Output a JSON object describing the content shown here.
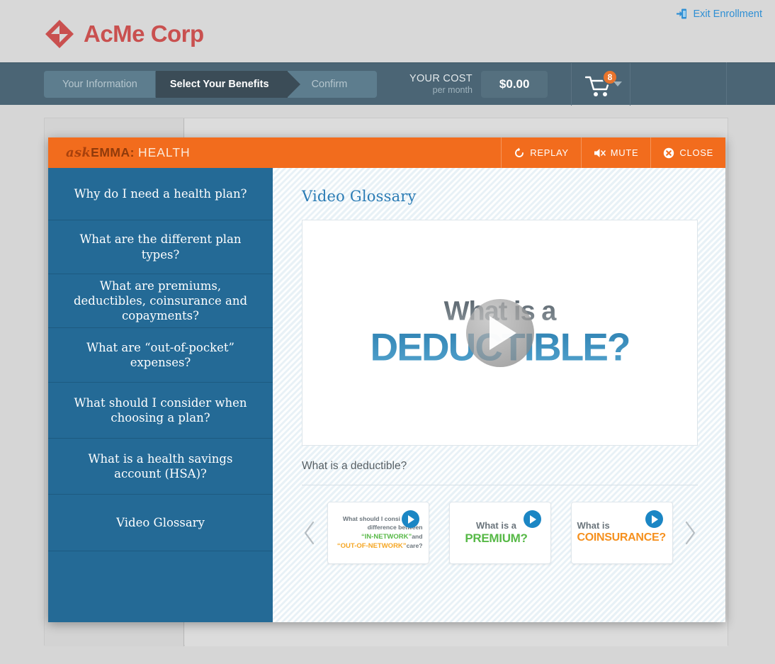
{
  "brand": {
    "name": "AcMe Corp",
    "logo_icon": "diamond-logo-icon",
    "logo_color": "#c9504f"
  },
  "header": {
    "exit_label": "Exit Enrollment",
    "exit_icon": "exit-door-icon",
    "exit_color": "#2f8fd4"
  },
  "progress": {
    "steps": [
      {
        "label": "Your Information",
        "active": false
      },
      {
        "label": "Select Your Benefits",
        "active": true
      },
      {
        "label": "Confirm",
        "active": false
      }
    ]
  },
  "cost": {
    "title": "YOUR COST",
    "subtitle": "per month",
    "amount": "$0.00"
  },
  "cart": {
    "icon": "shopping-cart-icon",
    "badge_count": "8",
    "badge_color": "#e8742c",
    "caret_icon": "chevron-down-icon"
  },
  "modal": {
    "title_ask": "ask",
    "title_emma": "EMMA",
    "title_colon": ":",
    "title_health": "HEALTH",
    "header_color": "#f26c1d",
    "buttons": [
      {
        "label": "REPLAY",
        "icon": "replay-circular-arrow-icon"
      },
      {
        "label": "MUTE",
        "icon": "speaker-mute-icon"
      },
      {
        "label": "CLOSE",
        "icon": "close-circle-x-icon"
      }
    ],
    "nav": {
      "accent_color": "#246a96",
      "items": [
        {
          "label": "Why do I need a health plan?",
          "active": false
        },
        {
          "label": "What are the different plan types?",
          "active": false
        },
        {
          "label": "What are premiums, deductibles, coinsurance and copayments?",
          "active": false
        },
        {
          "label": "What are “out-of-pocket” expenses?",
          "active": false
        },
        {
          "label": "What should I consider when choosing a plan?",
          "active": false
        },
        {
          "label": "What is a health savings account (HSA)?",
          "active": false
        },
        {
          "label": "Video Glossary",
          "active": true
        }
      ]
    },
    "content": {
      "title": "Video Glossary",
      "video": {
        "line1": "What is a",
        "line2": "DEDUCTIBLE?",
        "play_icon": "play-button-icon"
      },
      "caption": "What is a deductible?",
      "carousel": {
        "prev_icon": "chevron-left-icon",
        "next_icon": "chevron-right-icon",
        "thumbnails": [
          {
            "id": "network-thumb",
            "play_icon": "play-button-icon",
            "line1": "What should I consi",
            "line2": "difference between",
            "line3_a": "“IN-NETWORK”",
            "line3_b": "and",
            "line4_a": "“OUT-OF-NETWORK”",
            "line4_b": "care?"
          },
          {
            "id": "premium-thumb",
            "play_icon": "play-button-icon",
            "small": "What is a",
            "big": "PREMIUM?"
          },
          {
            "id": "coinsurance-thumb",
            "play_icon": "play-button-icon",
            "small": "What is",
            "big": "COINSURANCE?"
          }
        ]
      }
    }
  }
}
